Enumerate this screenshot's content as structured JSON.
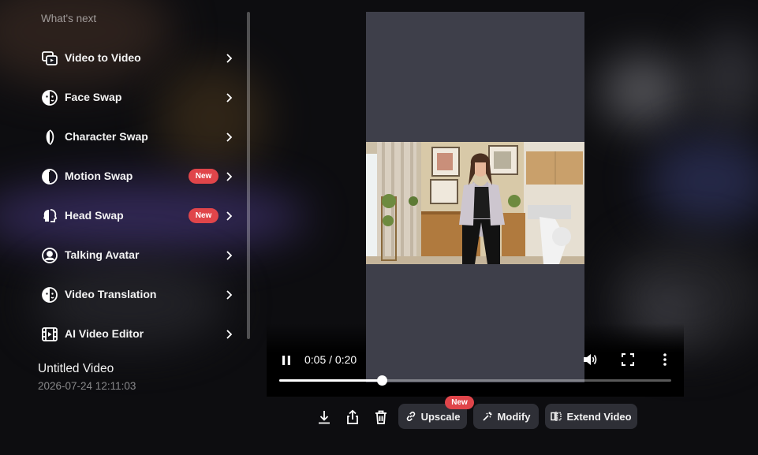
{
  "sidebar": {
    "section_title": "What's next",
    "items": [
      {
        "label": "Video to Video",
        "icon": "video-to-video-icon",
        "badge": ""
      },
      {
        "label": "Face Swap",
        "icon": "face-swap-icon",
        "badge": ""
      },
      {
        "label": "Character Swap",
        "icon": "character-swap-icon",
        "badge": ""
      },
      {
        "label": "Motion Swap",
        "icon": "motion-swap-icon",
        "badge": "New"
      },
      {
        "label": "Head Swap",
        "icon": "head-swap-icon",
        "badge": "New"
      },
      {
        "label": "Talking Avatar",
        "icon": "talking-avatar-icon",
        "badge": ""
      },
      {
        "label": "Video Translation",
        "icon": "video-translation-icon",
        "badge": ""
      },
      {
        "label": "AI Video Editor",
        "icon": "ai-video-editor-icon",
        "badge": ""
      }
    ]
  },
  "project": {
    "title": "Untitled Video",
    "timestamp": "2026-07-24 12:11:03"
  },
  "player": {
    "time_display": "0:05 / 0:20",
    "progress": 0.262,
    "state": "playing"
  },
  "toolbar": {
    "download_icon": "download-icon",
    "share_icon": "share-icon",
    "delete_icon": "trash-icon",
    "upscale_label": "Upscale",
    "upscale_badge": "New",
    "modify_label": "Modify",
    "extend_label": "Extend Video"
  },
  "colors": {
    "badge": "#e0454a",
    "button_bg": "#2e2f36",
    "video_letterbox": "#3e3f4a"
  }
}
